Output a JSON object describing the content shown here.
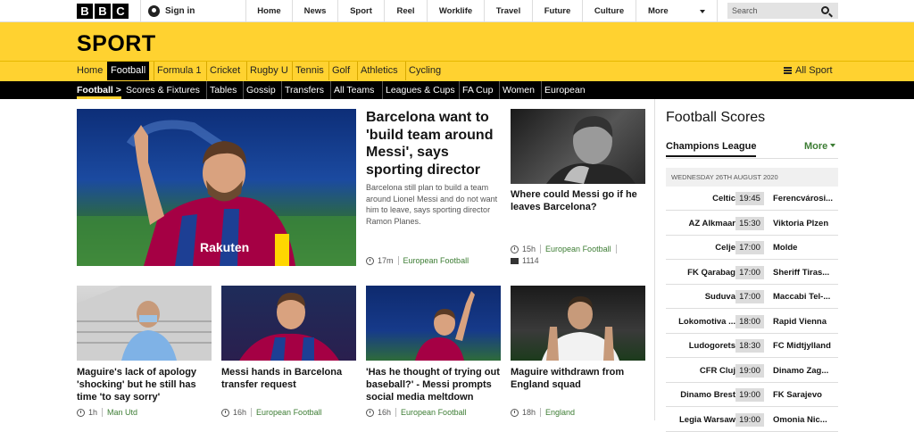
{
  "top": {
    "logo": [
      "B",
      "B",
      "C"
    ],
    "signin": "Sign in",
    "nav": [
      "Home",
      "News",
      "Sport",
      "Reel",
      "Worklife",
      "Travel",
      "Future",
      "Culture",
      "More"
    ],
    "search_placeholder": "Search"
  },
  "brand": {
    "title": "SPORT",
    "color": "#ffd230"
  },
  "sport_nav": [
    "Home",
    "Football",
    "Formula 1",
    "Cricket",
    "Rugby U",
    "Tennis",
    "Golf",
    "Athletics",
    "Cycling"
  ],
  "all_sport": "All Sport",
  "sub_nav": [
    "Football",
    "Scores & Fixtures",
    "Tables",
    "Gossip",
    "Transfers",
    "All Teams",
    "Leagues & Cups",
    "FA Cup",
    "Women",
    "European"
  ],
  "lead": {
    "headline": "Barcelona want to 'build team around Messi', says sporting director",
    "summary": "Barcelona still plan to build a team around Lionel Messi and do not want him to leave, says sporting director Ramon Planes.",
    "time": "17m",
    "tag": "European Football"
  },
  "side_story": {
    "headline": "Where could Messi go if he leaves Barcelona?",
    "time": "15h",
    "tag": "European Football",
    "comments": "1114"
  },
  "stories": [
    {
      "headline": "Maguire's lack of apology 'shocking' but he still has time 'to say sorry'",
      "time": "1h",
      "tag": "Man Utd"
    },
    {
      "headline": "Messi hands in Barcelona transfer request",
      "time": "16h",
      "tag": "European Football"
    },
    {
      "headline": "'Has he thought of trying out baseball?' - Messi prompts social media meltdown",
      "time": "16h",
      "tag": "European Football"
    },
    {
      "headline": "Maguire withdrawn from England squad",
      "time": "18h",
      "tag": "England"
    }
  ],
  "scores": {
    "title": "Football Scores",
    "tab": "Champions League",
    "more": "More",
    "date": "WEDNESDAY 26TH AUGUST 2020",
    "matches": [
      {
        "home": "Celtic",
        "time": "19:45",
        "away": "Ferencvárosi..."
      },
      {
        "home": "AZ Alkmaar",
        "time": "15:30",
        "away": "Viktoria Plzen"
      },
      {
        "home": "Celje",
        "time": "17:00",
        "away": "Molde"
      },
      {
        "home": "FK Qarabag",
        "time": "17:00",
        "away": "Sheriff Tiras..."
      },
      {
        "home": "Suduva",
        "time": "17:00",
        "away": "Maccabi Tel-..."
      },
      {
        "home": "Lokomotiva ...",
        "time": "18:00",
        "away": "Rapid Vienna"
      },
      {
        "home": "Ludogorets",
        "time": "18:30",
        "away": "FC Midtjylland"
      },
      {
        "home": "CFR Cluj",
        "time": "19:00",
        "away": "Dinamo Zag..."
      },
      {
        "home": "Dinamo Brest",
        "time": "19:00",
        "away": "FK Sarajevo"
      },
      {
        "home": "Legia Warsaw",
        "time": "19:00",
        "away": "Omonia Nic..."
      }
    ]
  }
}
